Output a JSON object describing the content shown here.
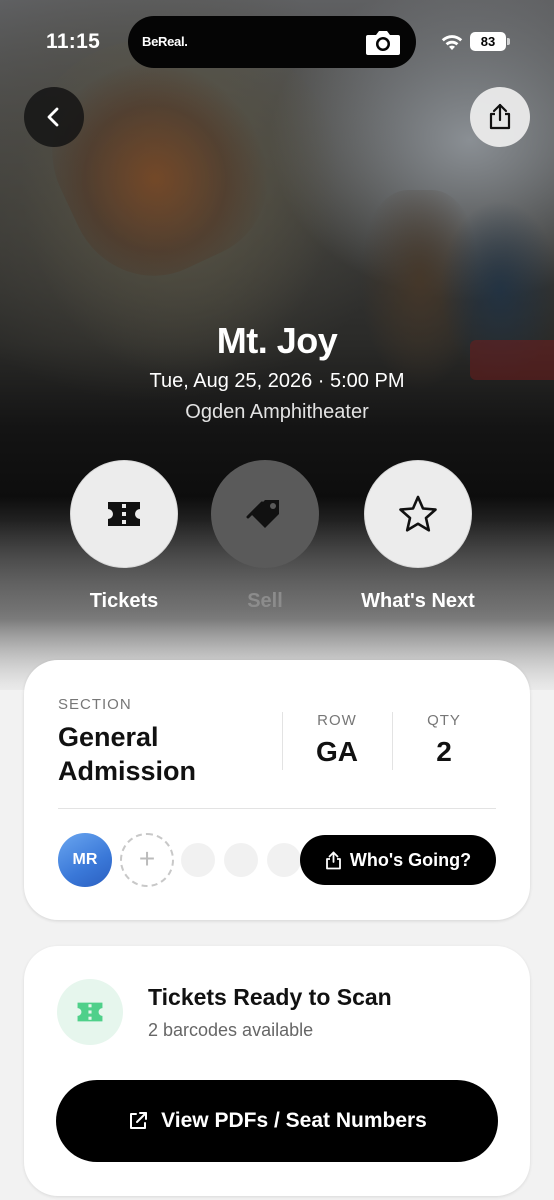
{
  "status_bar": {
    "time": "11:15",
    "island_label": "BeReal.",
    "battery": "83"
  },
  "event": {
    "title": "Mt. Joy",
    "datetime": "Tue, Aug 25, 2026 · 5:00 PM",
    "venue": "Ogden Amphitheater"
  },
  "actions": [
    {
      "label": "Tickets",
      "icon": "ticket-icon",
      "enabled": true
    },
    {
      "label": "Sell",
      "icon": "price-tag-icon",
      "enabled": false
    },
    {
      "label": "What's Next",
      "icon": "star-icon",
      "enabled": true
    }
  ],
  "ticket": {
    "section_label": "SECTION",
    "section_value": "General Admission",
    "row_label": "ROW",
    "row_value": "GA",
    "qty_label": "QTY",
    "qty_value": "2",
    "avatar_initials": "MR",
    "add_symbol": "+",
    "whos_going_label": "Who's Going?"
  },
  "scan": {
    "title": "Tickets Ready to Scan",
    "subtitle": "2 barcodes available",
    "button_label": "View PDFs / Seat Numbers"
  },
  "colors": {
    "accent_green": "#4fd08a",
    "avatar_blue": "#3a78d8"
  }
}
